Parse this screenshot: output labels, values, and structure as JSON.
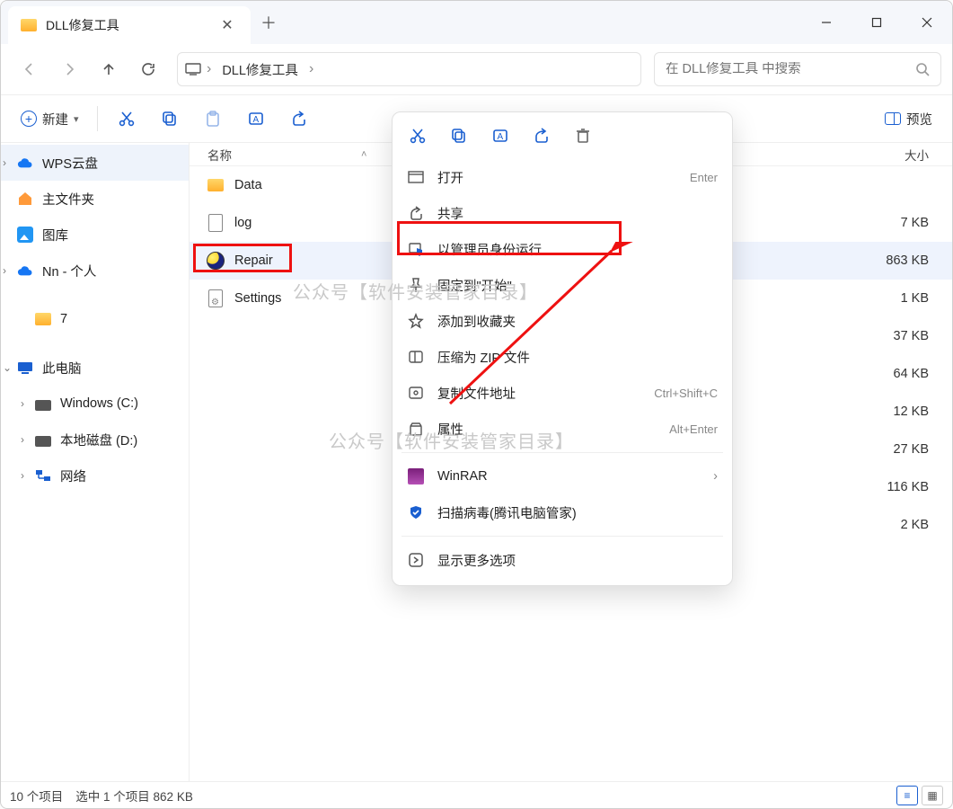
{
  "window": {
    "tab_title": "DLL修复工具"
  },
  "nav": {
    "breadcrumb": [
      "DLL修复工具"
    ],
    "search_placeholder": "在 DLL修复工具 中搜索"
  },
  "toolbar": {
    "new_label": "新建",
    "preview_label": "预览"
  },
  "columns": {
    "name": "名称",
    "size": "大小"
  },
  "sidebar": {
    "top": [
      {
        "label": "WPS云盘",
        "icon": "cloud-blue",
        "selected": true,
        "expandable": true
      },
      {
        "label": "主文件夹",
        "icon": "home"
      },
      {
        "label": "图库",
        "icon": "gallery"
      },
      {
        "label": "Nn - 个人",
        "icon": "cloud-blue",
        "expandable": true
      }
    ],
    "mid": [
      {
        "label": "7",
        "icon": "folder"
      }
    ],
    "bottom_header": {
      "label": "此电脑",
      "icon": "pc",
      "expanded": true
    },
    "bottom": [
      {
        "label": "Windows (C:)",
        "icon": "drive",
        "expandable": true
      },
      {
        "label": "本地磁盘 (D:)",
        "icon": "drive",
        "expandable": true
      },
      {
        "label": "网络",
        "icon": "net",
        "expandable": true
      }
    ]
  },
  "files": [
    {
      "name": "Data",
      "icon": "folder",
      "size": ""
    },
    {
      "name": "log",
      "icon": "txt",
      "size": "7 KB"
    },
    {
      "name": "Repair",
      "icon": "exe",
      "size": "863 KB",
      "selected": true
    },
    {
      "name": "Settings",
      "icon": "ini",
      "size": "1 KB"
    },
    {
      "name": "",
      "icon": "",
      "size": "37 KB"
    },
    {
      "name": "",
      "icon": "",
      "size": "64 KB"
    },
    {
      "name": "",
      "icon": "",
      "size": "12 KB"
    },
    {
      "name": "",
      "icon": "",
      "size": "27 KB"
    },
    {
      "name": "",
      "icon": "",
      "size": "116 KB"
    },
    {
      "name": "",
      "icon": "",
      "size": "2 KB"
    }
  ],
  "context_menu": {
    "items": [
      {
        "icon": "open",
        "label": "打开",
        "hint": "Enter"
      },
      {
        "icon": "share",
        "label": "共享"
      },
      {
        "icon": "admin",
        "label": "以管理员身份运行",
        "highlight": true
      },
      {
        "icon": "pin",
        "label": "固定到\"开始\""
      },
      {
        "icon": "star",
        "label": "添加到收藏夹"
      },
      {
        "icon": "zip",
        "label": "压缩为 ZIP 文件"
      },
      {
        "icon": "copypath",
        "label": "复制文件地址",
        "hint": "Ctrl+Shift+C"
      },
      {
        "icon": "props",
        "label": "属性",
        "hint": "Alt+Enter"
      },
      {
        "sep": true
      },
      {
        "icon": "winrar",
        "label": "WinRAR",
        "submenu": true
      },
      {
        "icon": "scan",
        "label": "扫描病毒(腾讯电脑管家)"
      },
      {
        "sep": true
      },
      {
        "icon": "more",
        "label": "显示更多选项"
      }
    ]
  },
  "status": {
    "count": "10 个项目",
    "selected": "选中 1 个项目  862 KB"
  },
  "watermark": "公众号【软件安装管家目录】"
}
